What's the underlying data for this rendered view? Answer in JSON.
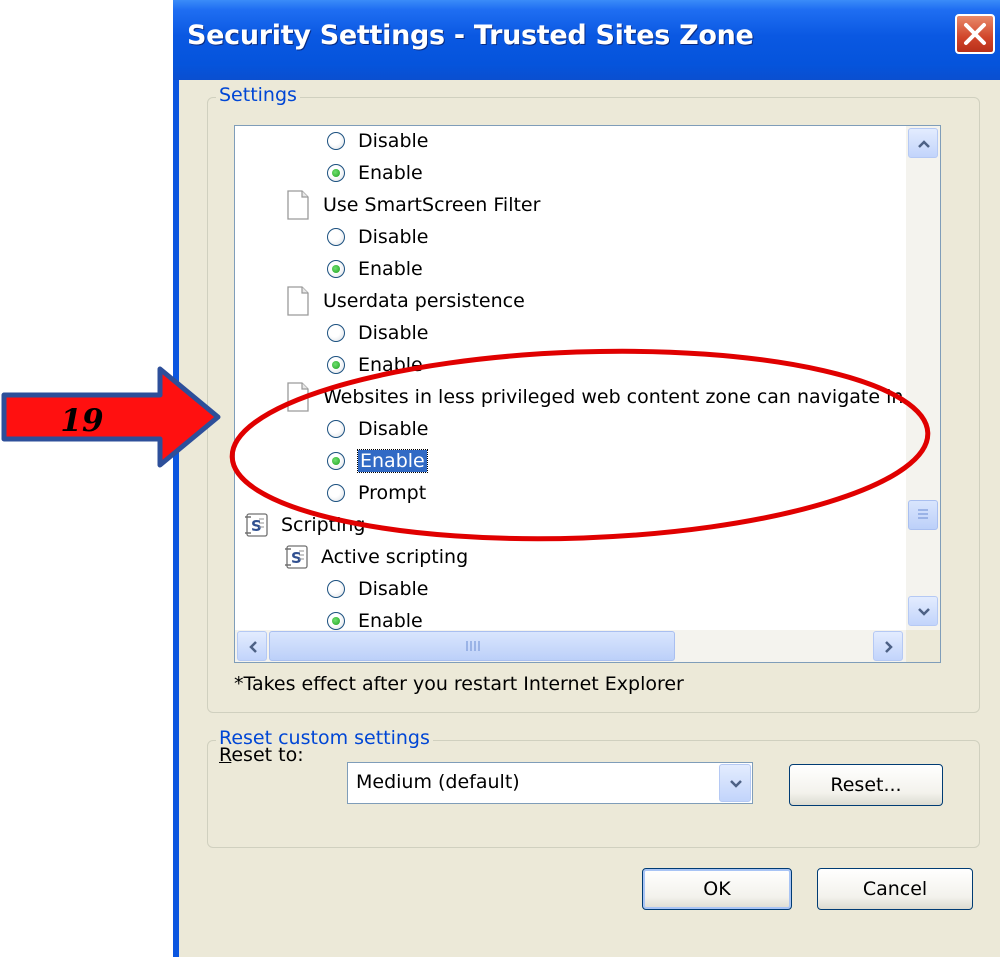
{
  "window": {
    "title": "Security Settings - Trusted Sites Zone"
  },
  "settings": {
    "group_label": "Settings",
    "tree_items": [
      {
        "kind": "radio",
        "label": "Disable",
        "checked": false
      },
      {
        "kind": "radio",
        "label": "Enable",
        "checked": true
      },
      {
        "kind": "doc",
        "label": "Use SmartScreen Filter"
      },
      {
        "kind": "radio",
        "label": "Disable",
        "checked": false
      },
      {
        "kind": "radio",
        "label": "Enable",
        "checked": true
      },
      {
        "kind": "doc",
        "label": "Userdata persistence"
      },
      {
        "kind": "radio",
        "label": "Disable",
        "checked": false
      },
      {
        "kind": "radio",
        "label": "Enable",
        "checked": true
      },
      {
        "kind": "doc",
        "label": "Websites in less privileged web content zone can navigate in"
      },
      {
        "kind": "radio",
        "label": "Disable",
        "checked": false
      },
      {
        "kind": "radio",
        "label": "Enable",
        "checked": true,
        "selected": true
      },
      {
        "kind": "radio",
        "label": "Prompt",
        "checked": false
      },
      {
        "kind": "script-category",
        "label": "Scripting"
      },
      {
        "kind": "script",
        "label": "Active scripting"
      },
      {
        "kind": "radio",
        "label": "Disable",
        "checked": false
      },
      {
        "kind": "radio",
        "label": "Enable",
        "checked": true
      }
    ],
    "note": "*Takes effect after you restart Internet Explorer"
  },
  "reset": {
    "group_label": "Reset custom settings",
    "reset_to_label": "Reset to:",
    "selected_level": "Medium (default)",
    "reset_button": "Reset..."
  },
  "buttons": {
    "ok": "OK",
    "cancel": "Cancel"
  },
  "annotation": {
    "step_number": "19",
    "arrow_color": "#ff0000",
    "ellipse_color": "#e00000"
  },
  "colors": {
    "titlebar": "#0554dc",
    "dialog_bg": "#ece9d8",
    "legend_text": "#0046d5",
    "selection": "#316ac5"
  }
}
